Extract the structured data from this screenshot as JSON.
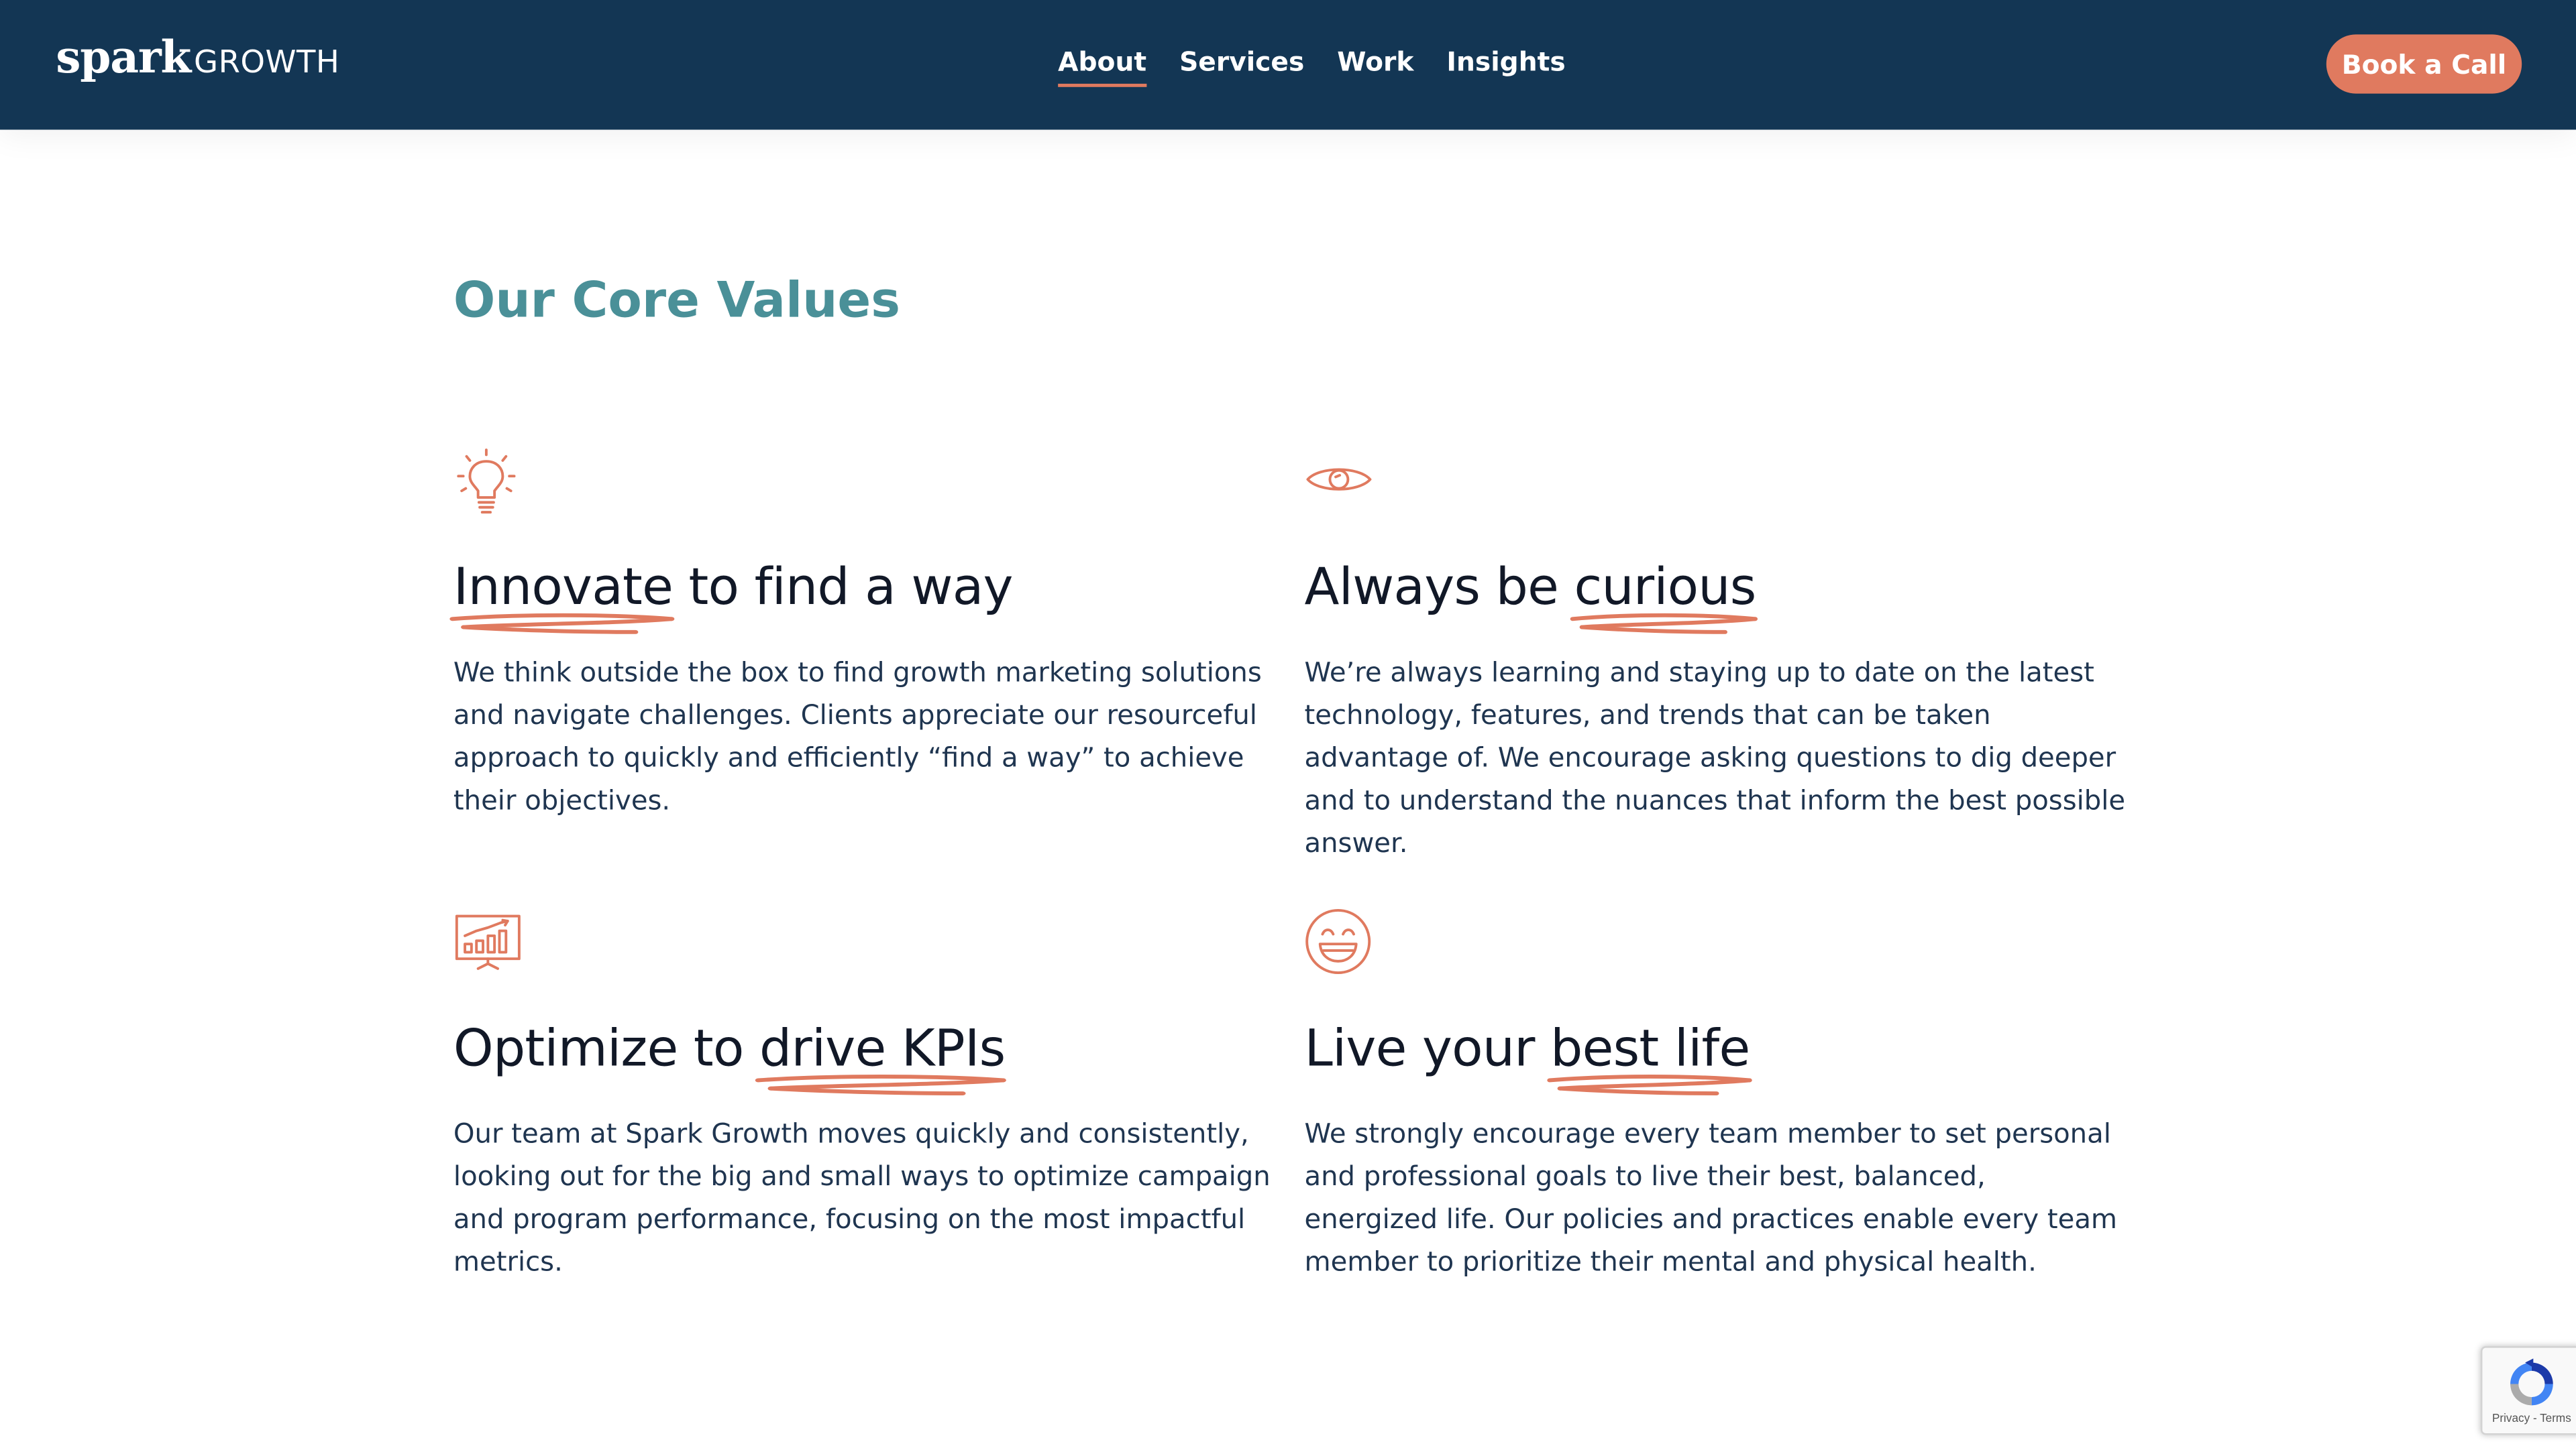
{
  "header": {
    "logo": {
      "word_main": "spark",
      "word_sub": "GROWTH"
    },
    "nav": [
      {
        "label": "About",
        "active": true
      },
      {
        "label": "Services",
        "active": false
      },
      {
        "label": "Work",
        "active": false
      },
      {
        "label": "Insights",
        "active": false
      }
    ],
    "cta_label": "Book a Call"
  },
  "section": {
    "title": "Our Core Values",
    "values": [
      {
        "icon": "lightbulb-icon",
        "title_pre": "",
        "title_highlight": "Innovate",
        "title_post": " to find a way",
        "body": "We think outside the box to find growth marketing solutions and navigate challenges. Clients appreciate our resourceful approach to quickly and efficiently “find a way” to achieve their objectives."
      },
      {
        "icon": "eye-icon",
        "title_pre": "Always be ",
        "title_highlight": "curious",
        "title_post": "",
        "body": "We’re always learning and staying up to date on the latest technology, features, and trends that can be taken advantage of. We encourage asking questions to dig deeper and to understand the nuances that inform the best possible answer."
      },
      {
        "icon": "presentation-chart-icon",
        "title_pre": "Optimize to ",
        "title_highlight": "drive KPIs",
        "title_post": "",
        "body": "Our team at Spark Growth moves quickly and consistently, looking out for the big and small ways to optimize campaign and program performance, focusing on the most impactful metrics."
      },
      {
        "icon": "smiley-face-icon",
        "title_pre": "Live your ",
        "title_highlight": "best life",
        "title_post": "",
        "body": "We strongly encourage every team member to set personal and professional goals to live their best, balanced, energized life. Our policies and practices enable every team member to prioritize their mental and physical health."
      }
    ]
  },
  "recaptcha": {
    "text": "Privacy - Terms"
  },
  "colors": {
    "header_bg": "#133654",
    "accent": "#e07a5f",
    "section_title": "#4a9098",
    "heading_text": "#111827",
    "body_text": "#1f3550"
  }
}
